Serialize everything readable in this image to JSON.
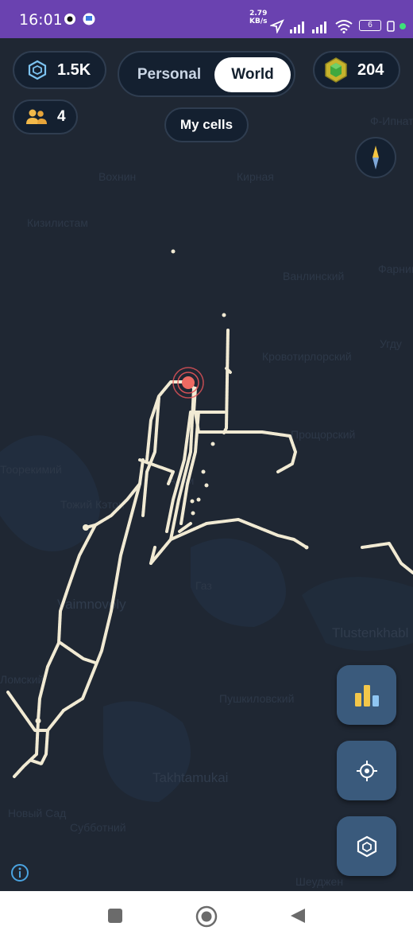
{
  "status_bar": {
    "time": "16:01",
    "speed_value": "2.79",
    "speed_unit": "KB/s",
    "battery": "6",
    "icons": [
      "nfc-app-icon",
      "app-icon",
      "location-arrow-icon",
      "signal-icon",
      "signal-icon",
      "wifi-icon",
      "battery-icon",
      "vibrate-icon",
      "dot-icon"
    ]
  },
  "top_bar": {
    "cells_count": "1.5K",
    "friends_count": "4",
    "toggle": {
      "options": [
        "Personal",
        "World"
      ],
      "selected": "World"
    },
    "gems_count": "204",
    "my_cells_label": "My cells"
  },
  "map": {
    "place_labels": [
      "Вохнин",
      "Кирная",
      "Кизилистам",
      "Ванлинский",
      "Кровотирлорский",
      "Прощорский",
      "Угду",
      "Тоорекимий",
      "Тожий Кэтон",
      "Алхи",
      "Vaimnovoly",
      "Газ",
      "Пушкиловский",
      "Tlustenkhabl",
      "Ломский",
      "Takhtamukai",
      "Новый Сад",
      "Субботний",
      "Шеуджен",
      "Фарнинский",
      "Понез",
      "Ф-Ипнат"
    ]
  },
  "fab_buttons": [
    "leaderboard-icon",
    "locate-icon",
    "hexagon-icon"
  ],
  "nav_bar": [
    "recents-button",
    "home-button",
    "back-button"
  ],
  "colors": {
    "status_bar": "#6a42b0",
    "map_bg": "#1f2733",
    "trail": "#f1ead3",
    "location": "#e8555a",
    "fab": "#3a5a7c",
    "gem": "#d4c23a"
  }
}
